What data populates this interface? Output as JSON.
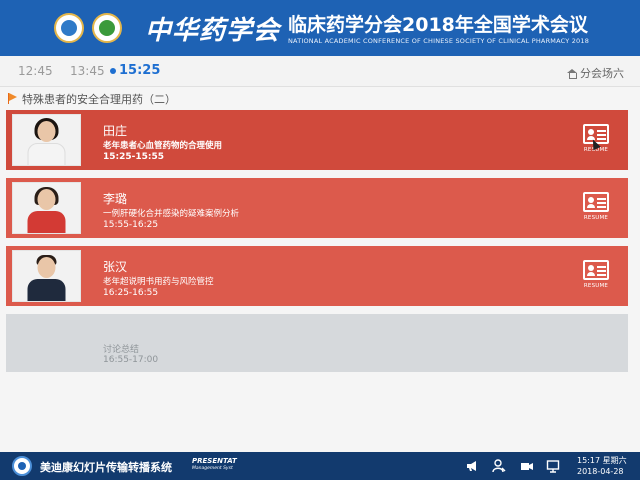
{
  "header": {
    "brand": "中华药学会",
    "title": "临床药学分会2018年全国学术会议",
    "subtitle": "NATIONAL ACADEMIC CONFERENCE OF CHINESE SOCIETY OF CLINICAL PHARMACY 2018"
  },
  "timebar": {
    "tabs": [
      "12:45",
      "13:45",
      "15:25"
    ],
    "active_index": 2,
    "venue": "分会场六"
  },
  "session": {
    "title": "特殊患者的安全合理用药（二）"
  },
  "talks": [
    {
      "speaker": "田庄",
      "title": "老年患者心血管药物的合理使用",
      "time": "15:25-15:55",
      "resume_label": "RESUME",
      "active": true
    },
    {
      "speaker": "李璐",
      "title": "一例肝硬化合并感染的疑难案例分析",
      "time": "15:55-16:25",
      "resume_label": "RESUME",
      "active": false
    },
    {
      "speaker": "张汉",
      "title": "老年超说明书用药与风险管控",
      "time": "16:25-16:55",
      "resume_label": "RESUME",
      "active": false
    }
  ],
  "discussion": {
    "title": "讨论总结",
    "time": "16:55-17:00"
  },
  "taskbar": {
    "app_name": "美迪康幻灯片传输转播系统",
    "app_brand": "PRESENTAT",
    "app_brand_sub": "Management Syst",
    "clock_time": "15:17 星期六",
    "clock_date": "2018-04-28"
  },
  "colors": {
    "header_blue": "#1e62b4",
    "active_tab": "#1e6fd1",
    "card_red": "#dc5a4c",
    "card_active": "#d04a3c",
    "discussion_grey": "#d6d9dc",
    "taskbar": "#123a6e"
  }
}
